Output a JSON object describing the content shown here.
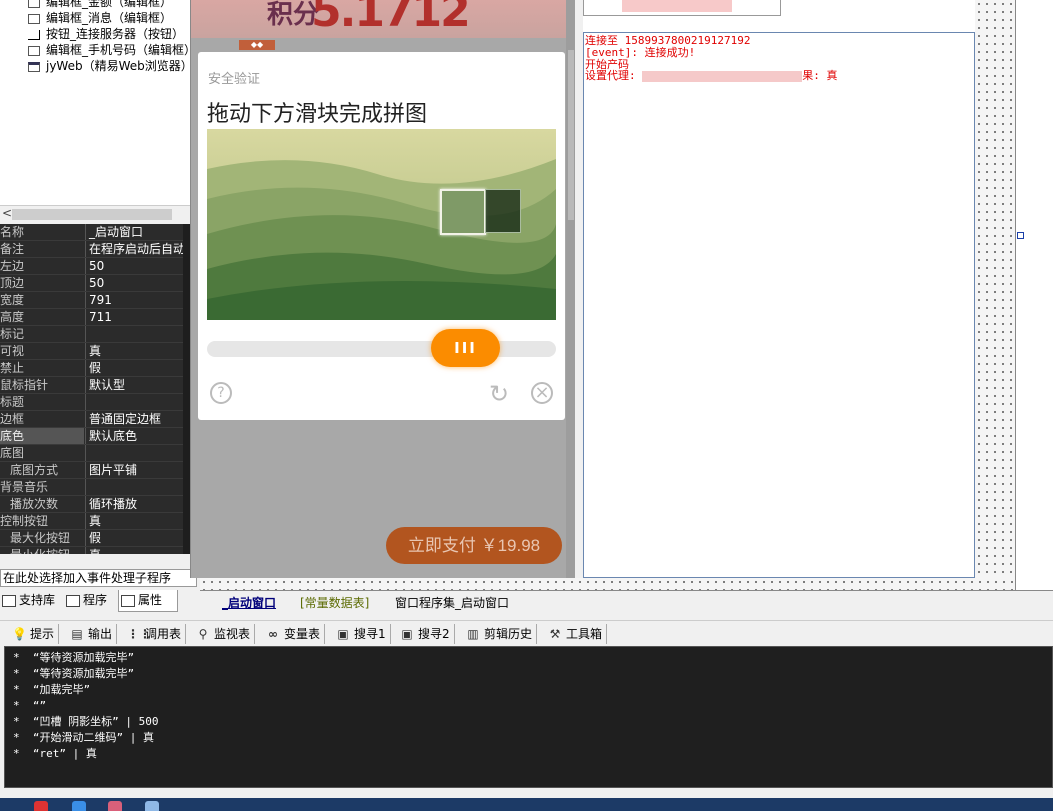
{
  "tree": {
    "items": [
      "编辑框_金额（编辑框）",
      "编辑框_消息（编辑框）",
      "按钮_连接服务器（按钮）",
      "编辑框_手机号码（编辑框）",
      "jyWeb（精易Web浏览器）"
    ]
  },
  "properties": [
    {
      "name": "名称",
      "value": "_启动窗口"
    },
    {
      "name": "备注",
      "value": "在程序启动后自动"
    },
    {
      "name": "左边",
      "value": "50"
    },
    {
      "name": "顶边",
      "value": "50"
    },
    {
      "name": "宽度",
      "value": "791"
    },
    {
      "name": "高度",
      "value": "711"
    },
    {
      "name": "标记",
      "value": ""
    },
    {
      "name": "可视",
      "value": "真"
    },
    {
      "name": "禁止",
      "value": "假"
    },
    {
      "name": "鼠标指针",
      "value": "默认型"
    },
    {
      "name": "标题",
      "value": ""
    },
    {
      "name": "边框",
      "value": "普通固定边框"
    },
    {
      "name": "底色",
      "value": "默认底色"
    },
    {
      "name": "底图",
      "value": ""
    },
    {
      "name": "底图方式",
      "value": "图片平铺"
    },
    {
      "name": "背景音乐",
      "value": ""
    },
    {
      "name": "播放次数",
      "value": "循环播放"
    },
    {
      "name": "控制按钮",
      "value": "真"
    },
    {
      "name": "最大化按钮",
      "value": "假"
    },
    {
      "name": "最小化按钮",
      "value": "真"
    }
  ],
  "event_combo": "在此处选择加入事件处理子程序",
  "left_tabs": [
    "支持库",
    "程序",
    "属性"
  ],
  "browser": {
    "banner_text": "5.1712",
    "banner_sub": "积分",
    "pay_button": "立即支付 ￥19.98"
  },
  "captcha": {
    "title": "安全验证",
    "instruction": "拖动下方滑块完成拼图",
    "slider_glyph": "III",
    "help_icon": "?",
    "refresh_icon": "↻",
    "close_icon": "×",
    "slider_progress": 0.73
  },
  "log": {
    "lines": [
      "连接至 15899378002191271​92",
      "[event]: 连接成功!",
      "开始产码",
      "设置代理:"
    ],
    "proxy_result": "果: 真"
  },
  "designer_tabs": [
    "_启动窗口",
    "[常量数据表]",
    "窗口程序集_启动窗口"
  ],
  "output_tools": [
    "提示",
    "输出",
    "调用表",
    "监视表",
    "变量表",
    "搜寻1",
    "搜寻2",
    "剪辑历史",
    "工具箱"
  ],
  "output_lines": [
    "*  “等待资源加载完毕”",
    "*  “等待资源加载完毕”",
    "*  “加载完毕”",
    "*  “”",
    "*  “凹槽 阴影坐标” | 500",
    "*  “开始滑动二维码” | 真",
    "*  “ret” | 真"
  ],
  "colors": {
    "slider": "#fb8c00",
    "log_text": "#e00000",
    "pay_button": "#b2551f"
  }
}
